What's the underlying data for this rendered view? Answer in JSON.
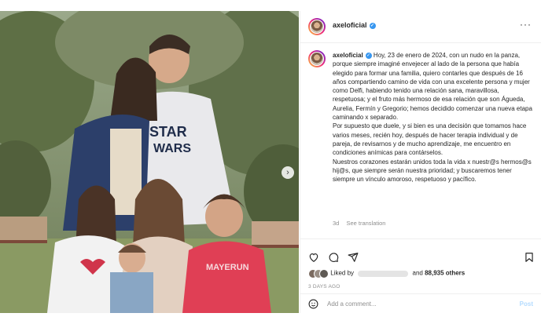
{
  "post": {
    "username": "axeloficial",
    "more_icon": "more-horizontal-icon",
    "caption_username": "axeloficial",
    "caption_paragraphs": [
      "Hoy, 23 de enero de 2024, con un nudo en la panza, porque siempre imaginé envejecer al lado de la persona que había elegido para formar una familia, quiero contarles que después de 16 años compartiendo camino de vida con una excelente persona y mujer como Delfi, habiendo tenido una relación sana, maravillosa, respetuosa; y el fruto más hermoso de esa relación que son Águeda, Aurelia, Fermín y Gregorio; hemos decidido comenzar una nueva etapa caminando x separado.",
      "Por supuesto que duele, y si bien es una decisión que tomamos hace varios meses, recién hoy, después de hacer terapia individual y de pareja, de revisarnos y de mucho aprendizaje, me encuentro en condiciones anímicas para contárselos.",
      "Nuestros corazones estarán unidos toda la vida x nuestr@s hermos@s hij@s, que siempre serán nuestra prioridad; y buscaremos tener siempre un vínculo amoroso, respetuoso y pacífico."
    ],
    "time_ago": "3d",
    "see_translation": "See translation",
    "liked_by_prefix": "Liked by",
    "liked_by_and": "and",
    "likes_count": "88,935 others",
    "posted": "3 days ago",
    "comment_placeholder": "Add a comment...",
    "post_button": "Post"
  },
  "colors": {
    "accent": "#3897f0",
    "muted": "#8e8e8e",
    "post_disabled": "#b3dbff"
  }
}
